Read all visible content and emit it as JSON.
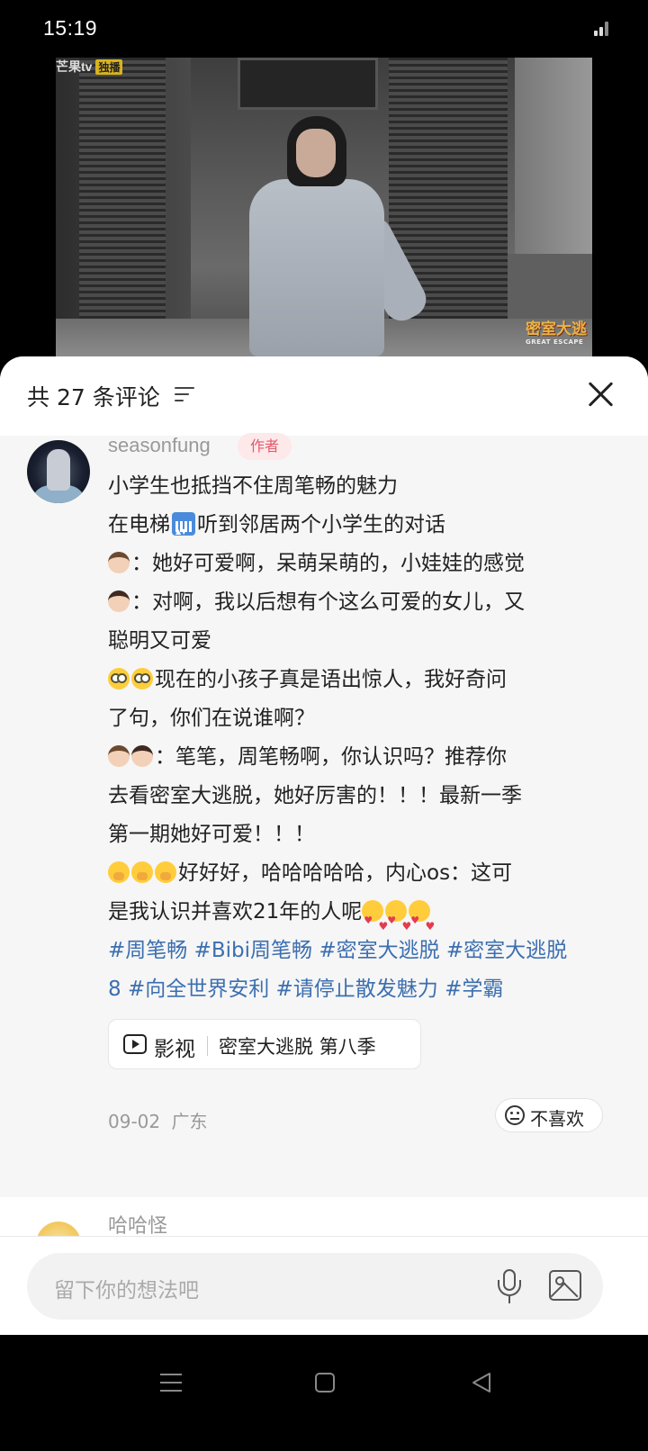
{
  "status_bar": {
    "time": "15:19"
  },
  "video": {
    "channel_logo": "芒果tv",
    "live_badge": "独播",
    "show_logo": "密室大逃",
    "show_logo_sub": "GREAT ESCAPE"
  },
  "comments": {
    "header_title": "共 27 条评论",
    "sort_icon": "sort-filter-icon",
    "close_icon": "close-icon",
    "items": [
      {
        "username": "seasonfung",
        "badge": "作者",
        "lines": [
          "小学生也抵挡不住周笔畅的魅力",
          "在电梯",
          "听到邻居两个小学生的对话",
          "：她好可爱啊，呆萌呆萌的，小娃娃的感觉",
          "：对啊，我以后想有个这么可爱的女儿，又",
          "聪明又可爱",
          "现在的小孩子真是语出惊人，我好奇问",
          "了句，你们在说谁啊？",
          "：笔笔，周笔畅啊，你认识吗？推荐你",
          "去看密室大逃脱，她好厉害的！！！最新一季",
          "第一期她好可爱！！！",
          "好好好，哈哈哈哈哈，内心os：这可",
          "是我认识并喜欢21年的人呢"
        ],
        "hashtags_line1": "#周笔畅 #Bibi周笔畅 #密室大逃脱 #密室大逃脱",
        "hashtags_line2": "8 #向全世界安利 #请停止散发魅力 #学霸",
        "tag_chip": {
          "kind": "影视",
          "title": "密室大逃脱 第八季"
        },
        "date": "09-02",
        "location": "广东",
        "dislike_label": "不喜欢"
      },
      {
        "username": "哈哈怪"
      }
    ]
  },
  "input": {
    "placeholder": "留下你的想法吧"
  },
  "colors": {
    "hashtag": "#3c6fb0",
    "author_badge_bg": "#fde8ea",
    "author_badge_text": "#e35a6a",
    "card_bg": "#f6f6f6"
  }
}
